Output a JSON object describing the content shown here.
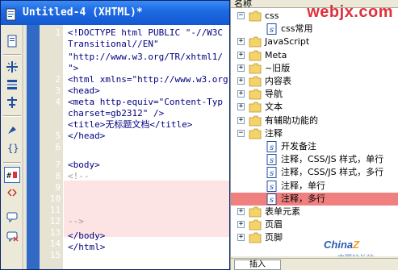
{
  "editor": {
    "title": "Untitled-4 (XHTML)*",
    "line_numbers": [
      "1",
      "2",
      "3",
      "4",
      "5",
      "6",
      "7",
      "8",
      "9",
      "10",
      "11",
      "12",
      "13",
      "14",
      "15"
    ],
    "code_lines": [
      "<!DOCTYPE html PUBLIC \"-//W3C",
      "Transitional//EN\"",
      "\"http://www.w3.org/TR/xhtml1/",
      "\">",
      "<html xmlns=\"http://www.w3.org",
      "<head>",
      "<meta http-equiv=\"Content-Typ",
      "charset=gb2312\" />",
      "<title>无标题文档</title>",
      "</head>",
      "",
      "<body>",
      "<!--",
      "",
      "",
      "",
      "-->",
      "</body>",
      "</html>"
    ],
    "toolbar_icons": [
      "file-view-icon",
      "expand-all-icon",
      "select-parent-icon",
      "balance-braces-icon",
      "line-numbers-icon",
      "highlight-icon",
      "indent-icon",
      "apply-comment-icon",
      "remove-comment-icon"
    ]
  },
  "panel": {
    "header": "名称",
    "watermark_top": "webjx.com",
    "watermark_bottom": "China",
    "watermark_sub": "中国站长站",
    "insert_tab": "插入",
    "tree": [
      {
        "label": "css",
        "type": "folder",
        "expander": "-",
        "indent": 1
      },
      {
        "label": "css常用",
        "type": "snippet",
        "expander": "",
        "indent": 2
      },
      {
        "label": "JavaScript",
        "type": "folder",
        "expander": "+",
        "indent": 1
      },
      {
        "label": "Meta",
        "type": "folder",
        "expander": "+",
        "indent": 1
      },
      {
        "label": "~旧版",
        "type": "folder",
        "expander": "+",
        "indent": 1
      },
      {
        "label": "内容表",
        "type": "folder",
        "expander": "+",
        "indent": 1
      },
      {
        "label": "导航",
        "type": "folder",
        "expander": "+",
        "indent": 1
      },
      {
        "label": "文本",
        "type": "folder",
        "expander": "+",
        "indent": 1
      },
      {
        "label": "有辅助功能的",
        "type": "folder",
        "expander": "+",
        "indent": 1
      },
      {
        "label": "注释",
        "type": "folder",
        "expander": "-",
        "indent": 1
      },
      {
        "label": "开发备注",
        "type": "snippet",
        "expander": "",
        "indent": 2
      },
      {
        "label": "注释，CSS/JS 样式，单行",
        "type": "snippet",
        "expander": "",
        "indent": 2
      },
      {
        "label": "注释，CSS/JS 样式，多行",
        "type": "snippet",
        "expander": "",
        "indent": 2
      },
      {
        "label": "注释，单行",
        "type": "snippet",
        "expander": "",
        "indent": 2
      },
      {
        "label": "注释，多行",
        "type": "snippet",
        "expander": "",
        "indent": 2,
        "selected": true
      },
      {
        "label": "表单元素",
        "type": "folder",
        "expander": "+",
        "indent": 1
      },
      {
        "label": "页眉",
        "type": "folder",
        "expander": "+",
        "indent": 1
      },
      {
        "label": "页脚",
        "type": "folder",
        "expander": "+",
        "indent": 1
      }
    ]
  },
  "colors": {
    "title_bar": "#1e6be3",
    "gutter_selection": "#316ac5",
    "comment_highlight": "#fde4e4",
    "selected_row": "#f08080",
    "folder": "#f5d36b",
    "watermark_red": "#e0303a"
  }
}
